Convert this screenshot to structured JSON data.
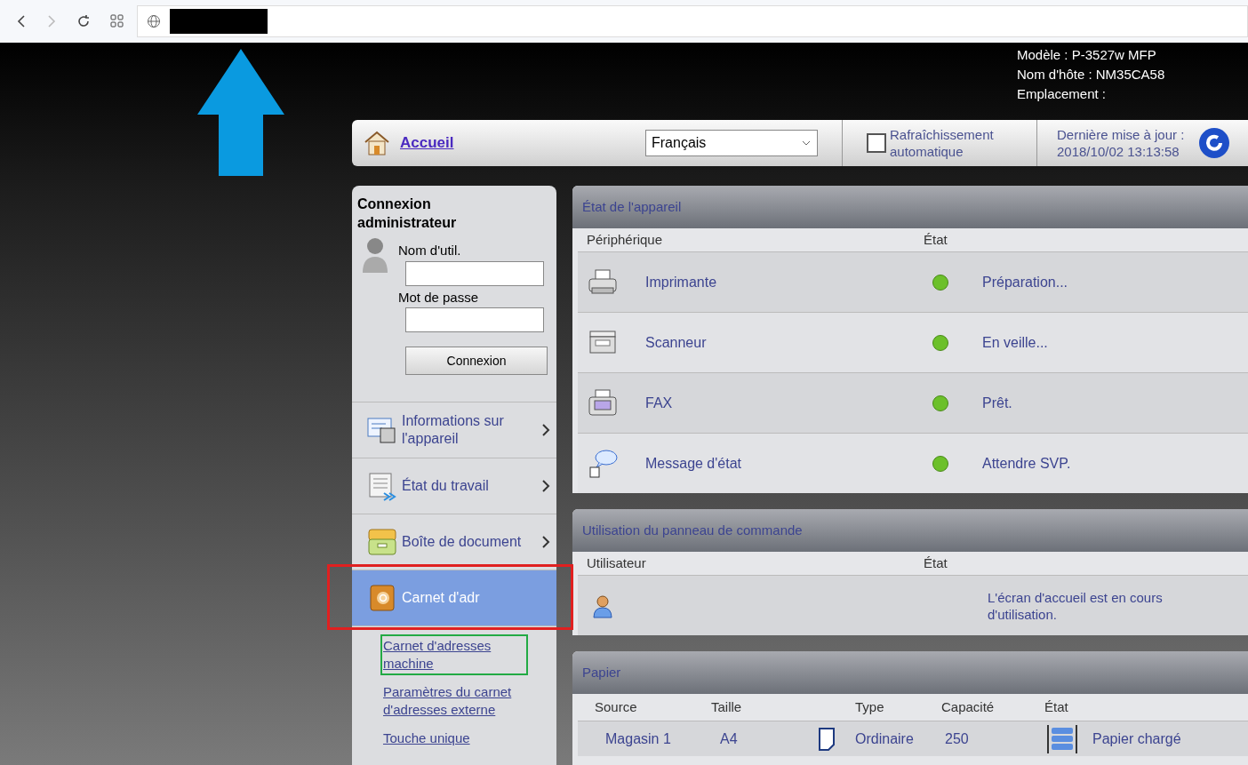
{
  "device_info": [
    "Modèle : P-3527w MFP",
    "Nom d'hôte : NM35CA58",
    "Emplacement :"
  ],
  "toolbar": {
    "home": "Accueil",
    "language": "Français",
    "auto_refresh": {
      "label": "Rafraîchissement automatique",
      "checked": false
    },
    "last_update": [
      "Dernière mise à jour :",
      "2018/10/02 13:13:58"
    ]
  },
  "login": {
    "title": "Connexion administrateur",
    "username_label": "Nom d'util.",
    "password_label": "Mot de passe",
    "button": "Connexion"
  },
  "nav": [
    {
      "kind": "info",
      "label": "Informations sur l'appareil",
      "selected": false
    },
    {
      "kind": "job",
      "label": "État du travail",
      "selected": false
    },
    {
      "kind": "box",
      "label": "Boîte de document",
      "selected": false
    },
    {
      "kind": "book",
      "label": "Carnet d'adr",
      "selected": true,
      "children": [
        {
          "label": "Carnet d'adresses machine",
          "highlighted": true
        },
        {
          "label": "Paramètres du carnet d'adresses externe",
          "highlighted": false
        },
        {
          "label": "Touche unique",
          "highlighted": false
        }
      ]
    }
  ],
  "device_status": {
    "title": "État de l'appareil",
    "columns": [
      "Périphérique",
      "État"
    ],
    "rows": [
      {
        "kind": "printer",
        "name": "Imprimante",
        "status": "Préparation..."
      },
      {
        "kind": "scanner",
        "name": "Scanneur",
        "status": "En veille..."
      },
      {
        "kind": "fax",
        "name": "FAX",
        "status": "Prêt."
      },
      {
        "kind": "message",
        "name": "Message d'état",
        "status": "Attendre SVP."
      }
    ]
  },
  "panel_usage": {
    "title": "Utilisation du panneau de commande",
    "columns": [
      "Utilisateur",
      "État"
    ],
    "rows": [
      {
        "status": "L'écran d'accueil est en cours d'utilisation."
      }
    ]
  },
  "paper": {
    "title": "Papier",
    "columns": [
      "Source",
      "Taille",
      "Type",
      "Capacité",
      "État"
    ],
    "rows": [
      {
        "source": "Magasin 1",
        "size": "A4",
        "type": "Ordinaire",
        "capacity": "250",
        "status": "Papier chargé"
      }
    ]
  }
}
